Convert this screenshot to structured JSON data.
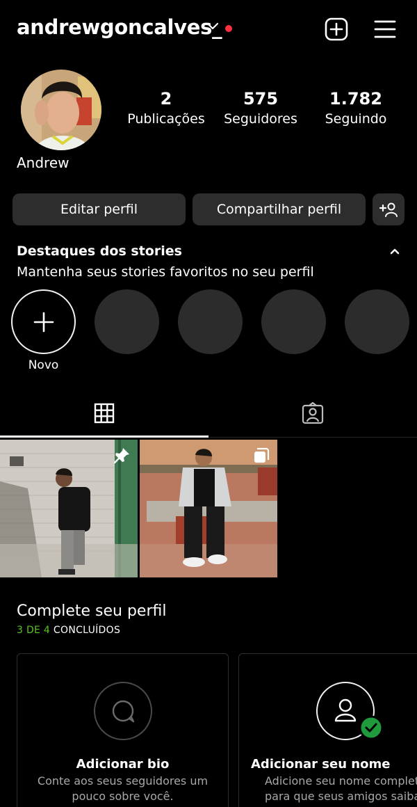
{
  "colors": {
    "background": "#000000",
    "button_bg": "#2d2d2d",
    "highlight_bg": "#2c2c2c",
    "notification": "#ff3040",
    "progress_done": "#58c322"
  },
  "header": {
    "username": "andrewgoncalves_",
    "icons": [
      "chevron-down-icon",
      "notification-dot",
      "new-post-icon",
      "menu-icon"
    ]
  },
  "profile": {
    "display_name": "Andrew",
    "stats": [
      {
        "value": "2",
        "label": "Publicações"
      },
      {
        "value": "575",
        "label": "Seguidores"
      },
      {
        "value": "1.782",
        "label": "Seguindo"
      }
    ]
  },
  "actions": {
    "edit_label": "Editar perfil",
    "share_label": "Compartilhar perfil",
    "discover_icon": "add-person-icon"
  },
  "highlights": {
    "title": "Destaques dos stories",
    "subtitle": "Mantenha seus stories favoritos no seu perfil",
    "new_label": "Novo"
  },
  "tabs": [
    {
      "name": "posts-grid",
      "icon": "grid-icon",
      "selected": true
    },
    {
      "name": "tagged",
      "icon": "tagged-user-icon",
      "selected": false
    }
  ],
  "posts": [
    {
      "badge": "pin-icon"
    },
    {
      "badge": "carousel-icon"
    }
  ],
  "complete_profile": {
    "title": "Complete seu perfil",
    "progress_done": "3 DE 4",
    "progress_rest": "CONCLUÍDOS",
    "cards": [
      {
        "title": "Adicionar bio",
        "description": "Conte aos seus seguidores um\npouco sobre você.",
        "icon": "speech-bubble-icon",
        "completed": false
      },
      {
        "title": "Adicionar seu nome",
        "description": "Adicione seu nome complet\npara que seus amigos saiba",
        "icon": "person-icon",
        "completed": true
      }
    ]
  }
}
